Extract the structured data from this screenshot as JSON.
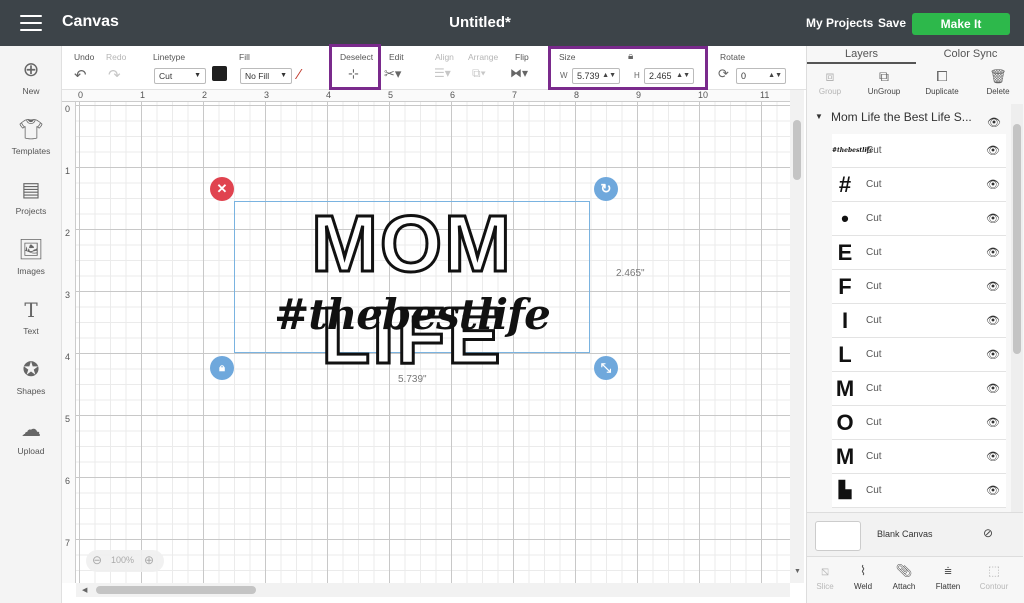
{
  "app": {
    "title": "Canvas",
    "document_title": "Untitled*"
  },
  "topbar": {
    "my_projects": "My Projects",
    "save": "Save",
    "make_it": "Make It",
    "make_it_color": "#2db84b"
  },
  "toolbar": {
    "undo": "Undo",
    "redo": "Redo",
    "linetype_label": "Linetype",
    "linetype_value": "Cut",
    "fill_label": "Fill",
    "fill_value": "No Fill",
    "deselect": "Deselect",
    "edit": "Edit",
    "align": "Align",
    "arrange": "Arrange",
    "flip": "Flip",
    "size_label": "Size",
    "w_label": "W",
    "width": "5.739",
    "h_label": "H",
    "height": "2.465",
    "rotate_label": "Rotate",
    "rotate_value": "0"
  },
  "left_nav": [
    {
      "label": "New",
      "icon": "plus-circle-icon"
    },
    {
      "label": "Templates",
      "icon": "tshirt-icon"
    },
    {
      "label": "Projects",
      "icon": "projects-icon"
    },
    {
      "label": "Images",
      "icon": "image-icon"
    },
    {
      "label": "Text",
      "icon": "text-icon"
    },
    {
      "label": "Shapes",
      "icon": "shapes-icon"
    },
    {
      "label": "Upload",
      "icon": "upload-cloud-icon"
    }
  ],
  "ruler": {
    "top": [
      "0",
      "1",
      "2",
      "3",
      "4",
      "5",
      "6",
      "7",
      "8",
      "9",
      "10",
      "11"
    ],
    "left": [
      "0",
      "1",
      "2",
      "3",
      "4",
      "5",
      "6",
      "7"
    ]
  },
  "canvas": {
    "headline": "MOM LIFE",
    "subline": "#thebestlife",
    "width_label": "5.739\"",
    "height_label": "2.465\"",
    "zoom": "100%"
  },
  "right_panel": {
    "tabs": [
      "Layers",
      "Color Sync"
    ],
    "actions": [
      "Group",
      "UnGroup",
      "Duplicate",
      "Delete"
    ],
    "group_name": "Mom Life the Best Life S...",
    "layers": [
      {
        "thumb": "#thebestlife",
        "op": "Cut"
      },
      {
        "thumb": "#",
        "op": "Cut"
      },
      {
        "thumb": "•",
        "op": "Cut"
      },
      {
        "thumb": "E",
        "op": "Cut"
      },
      {
        "thumb": "F",
        "op": "Cut"
      },
      {
        "thumb": "I",
        "op": "Cut"
      },
      {
        "thumb": "L",
        "op": "Cut"
      },
      {
        "thumb": "M",
        "op": "Cut"
      },
      {
        "thumb": "O",
        "op": "Cut"
      },
      {
        "thumb": "M",
        "op": "Cut"
      },
      {
        "thumb": "▙",
        "op": "Cut"
      }
    ],
    "blank_canvas": "Blank Canvas",
    "bottom_actions": [
      "Slice",
      "Weld",
      "Attach",
      "Flatten",
      "Contour"
    ]
  },
  "colors": {
    "topbar": "#3d4449",
    "highlight": "#7a2a8c",
    "handle_blue": "#6fa8dc",
    "handle_red": "#e0434f"
  }
}
